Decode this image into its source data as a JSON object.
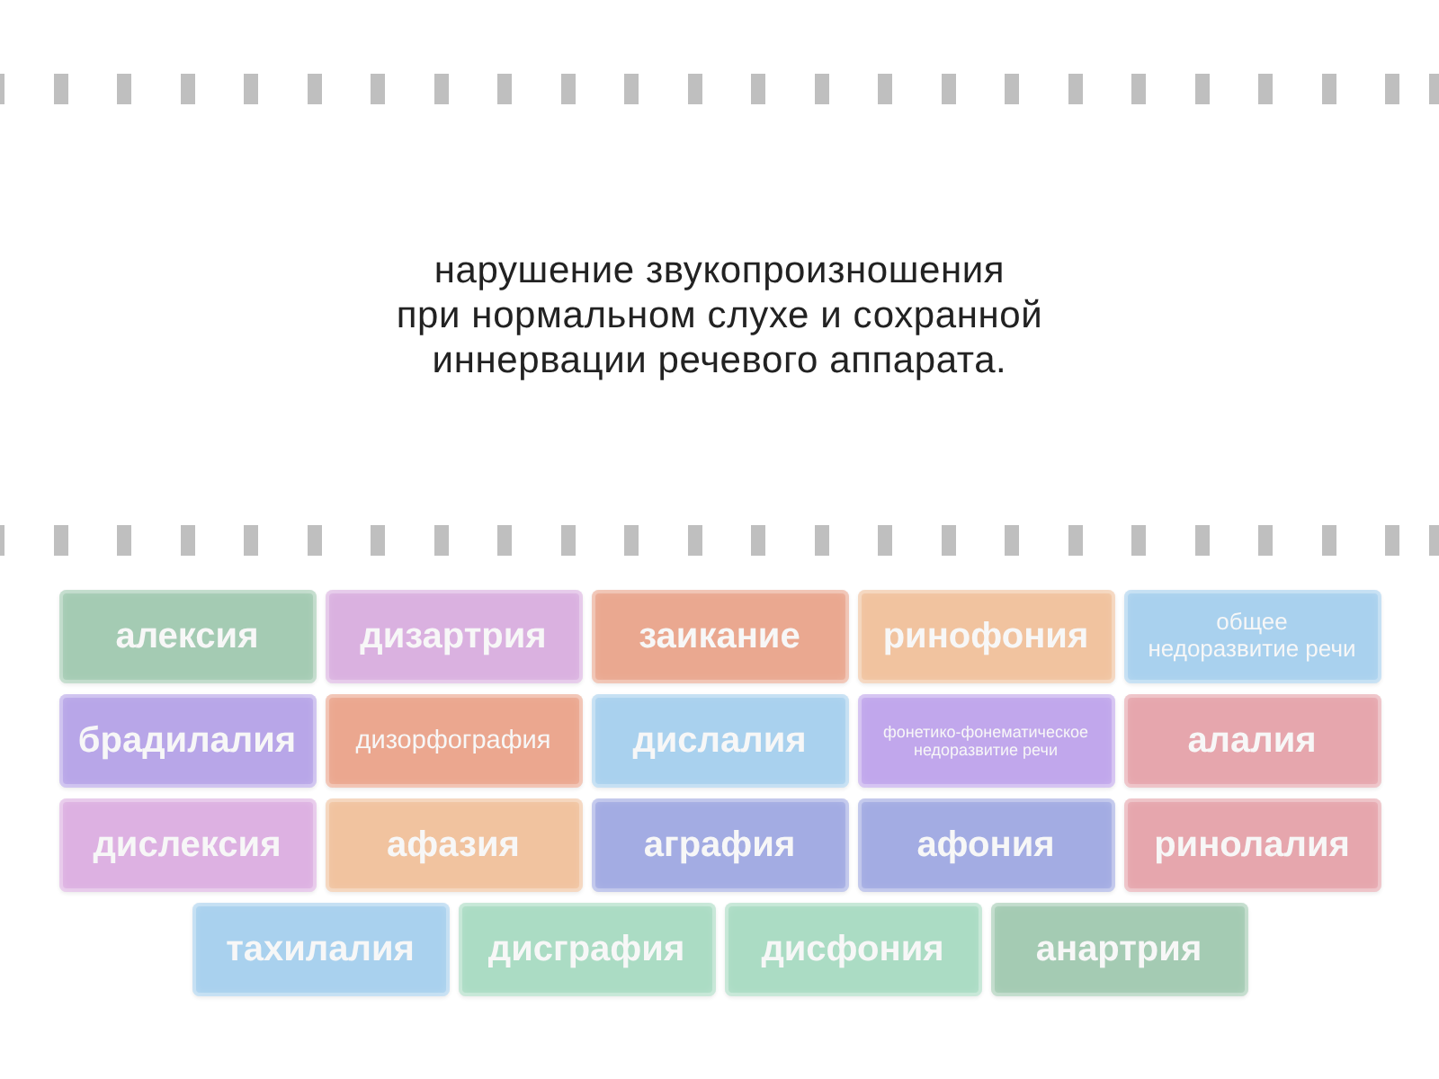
{
  "question": {
    "text": "нарушение звукопроизношения\nпри нормальном слухе и сохранной\nиннервации речевого аппарата."
  },
  "answers": [
    {
      "label": "алексия",
      "color": "#a4cbb3"
    },
    {
      "label": "дизартрия",
      "color": "#dab1e0"
    },
    {
      "label": "заикание",
      "color": "#eaa890"
    },
    {
      "label": "ринофония",
      "color": "#f1c39f"
    },
    {
      "label": "общее недоразвитие речи",
      "color": "#a9d1ee"
    },
    {
      "label": "брадилалия",
      "color": "#b8a6e8"
    },
    {
      "label": "дизорфография",
      "color": "#eba78f"
    },
    {
      "label": "дислалия",
      "color": "#a9d1ee"
    },
    {
      "label": "фонетико-фонематическое недоразвитие речи",
      "color": "#c1a7ec"
    },
    {
      "label": "алалия",
      "color": "#e6a6ad"
    },
    {
      "label": "дислексия",
      "color": "#ddb1e2"
    },
    {
      "label": "афазия",
      "color": "#f1c39f"
    },
    {
      "label": "аграфия",
      "color": "#a3ace3"
    },
    {
      "label": "афония",
      "color": "#a3ace3"
    },
    {
      "label": "ринолалия",
      "color": "#e6a6ad"
    },
    {
      "label": "тахилалия",
      "color": "#a9d1ee"
    },
    {
      "label": "дисграфия",
      "color": "#abdcc4"
    },
    {
      "label": "дисфония",
      "color": "#abdcc4"
    },
    {
      "label": "анартрия",
      "color": "#a4cbb3"
    }
  ]
}
